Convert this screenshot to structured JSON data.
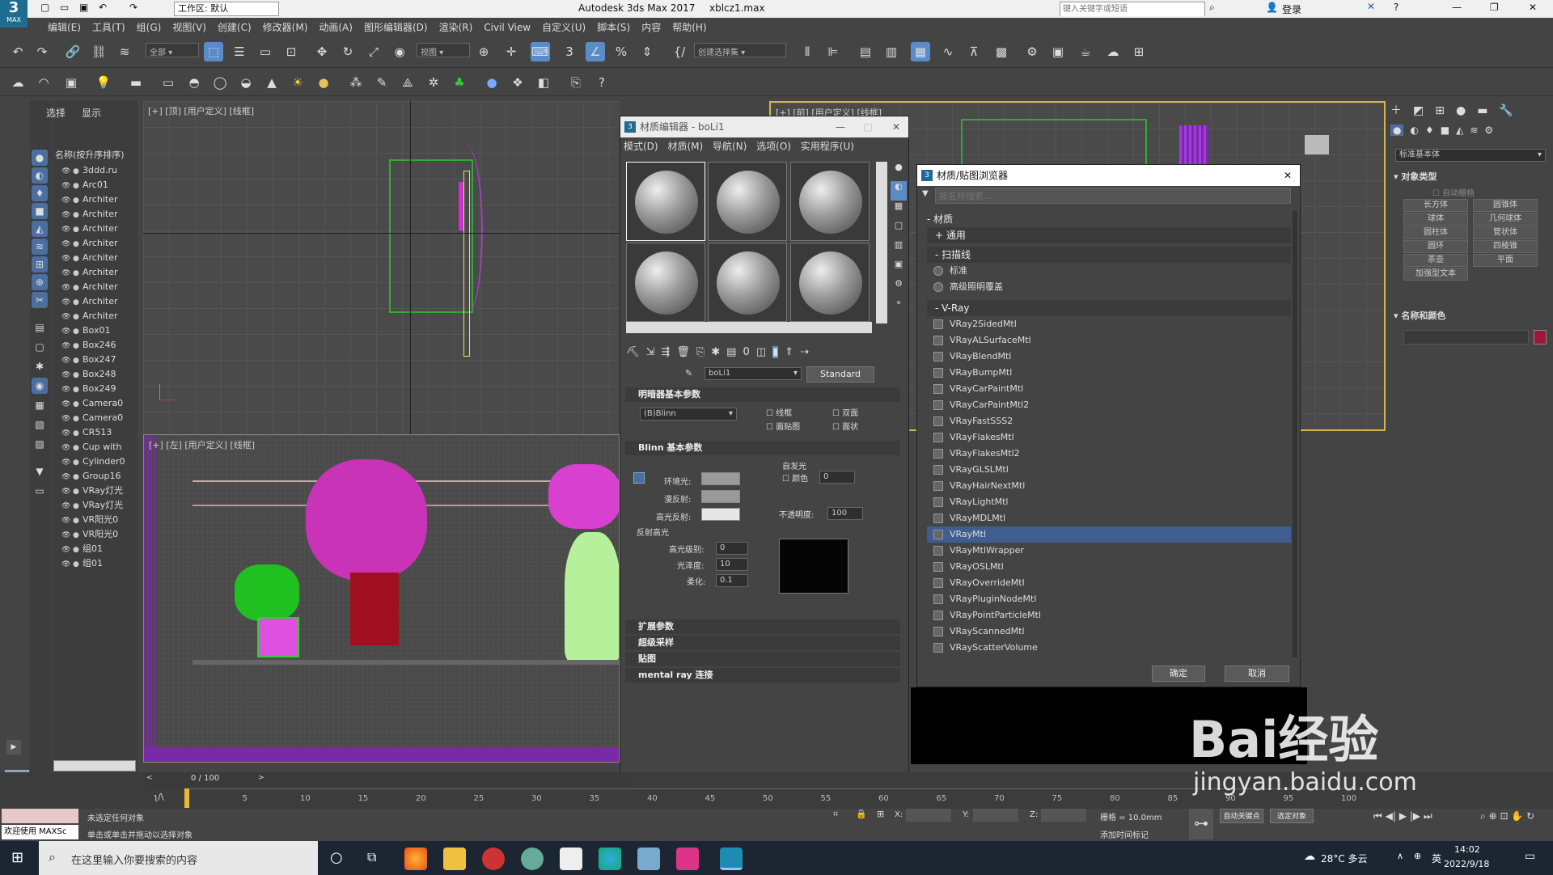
{
  "titlebar": {
    "logo": "3",
    "logo_sub": "MAX",
    "workspace": "工作区: 默认",
    "app_title": "Autodesk 3ds Max 2017",
    "file": "xblcz1.max",
    "search_placeholder": "键入关键字或短语",
    "login": "登录"
  },
  "menubar": [
    "编辑(E)",
    "工具(T)",
    "组(G)",
    "视图(V)",
    "创建(C)",
    "修改器(M)",
    "动画(A)",
    "图形编辑器(D)",
    "渲染(R)",
    "Civil View",
    "自定义(U)",
    "脚本(S)",
    "内容",
    "帮助(H)"
  ],
  "toolbar": {
    "filter_all": "全部",
    "view_mode": "视图",
    "selection_set": "创建选择集"
  },
  "explorer": {
    "tabs": [
      "选择",
      "显示"
    ],
    "header": "名称(按升序排序)",
    "items": [
      "3ddd.ru",
      "Arc01",
      "Architer",
      "Architer",
      "Architer",
      "Architer",
      "Architer",
      "Architer",
      "Architer",
      "Architer",
      "Architer",
      "Box01",
      "Box246",
      "Box247",
      "Box248",
      "Box249",
      "Camera0",
      "Camera0",
      "CR513",
      "Cup with",
      "Cylinder0",
      "Group16",
      "VRay灯光",
      "VRay灯光",
      "VR阳光0",
      "VR阳光0",
      "组01",
      "组01"
    ]
  },
  "viewports": {
    "top": "[+] [顶] [用户定义] [线框]",
    "front": "[+] [前] [用户定义] [线框]",
    "left": "[+] [左] [用户定义] [线框]",
    "frame_counter": "0 / 100"
  },
  "material_editor": {
    "title": "材质编辑器 - boLi1",
    "menu": [
      "模式(D)",
      "材质(M)",
      "导航(N)",
      "选项(O)",
      "实用程序(U)"
    ],
    "material_name": "boLi1",
    "material_type": "Standard",
    "shader_rollout": "明暗器基本参数",
    "shader": "(B)Blinn",
    "options": [
      "线框",
      "双面",
      "面贴图",
      "面状"
    ],
    "blinn_rollout": "Blinn 基本参数",
    "self_illum": "自发光",
    "color_label": "颜色",
    "self_illum_value": "0",
    "ambient": "环境光:",
    "diffuse": "漫反射:",
    "specular": "高光反射:",
    "opacity_label": "不透明度:",
    "opacity": "100",
    "spec_highlights": "反射高光",
    "spec_level_label": "高光级别:",
    "spec_level": "0",
    "glossiness_label": "光泽度:",
    "glossiness": "10",
    "soften_label": "柔化:",
    "soften": "0.1",
    "more_rollouts": [
      "扩展参数",
      "超级采样",
      "贴图",
      "mental ray 连接"
    ]
  },
  "browser": {
    "title": "材质/贴图浏览器",
    "search_placeholder": "按名称搜索...",
    "root": "- 材质",
    "general": "+ 通用",
    "scanline": "- 扫描线",
    "scanline_items": [
      "标准",
      "高级照明覆盖"
    ],
    "vray": "- V-Ray",
    "vray_items": [
      "VRay2SidedMtl",
      "VRayALSurfaceMtl",
      "VRayBlendMtl",
      "VRayBumpMtl",
      "VRayCarPaintMtl",
      "VRayCarPaintMtl2",
      "VRayFastSSS2",
      "VRayFlakesMtl",
      "VRayFlakesMtl2",
      "VRayGLSLMtl",
      "VRayHairNextMtl",
      "VRayLightMtl",
      "VRayMDLMtl",
      "VRayMtl",
      "VRayMtlWrapper",
      "VRayOSLMtl",
      "VRayOverrideMtl",
      "VRayPluginNodeMtl",
      "VRayPointParticleMtl",
      "VRayScannedMtl",
      "VRayScatterVolume"
    ],
    "selected": "VRayMtl",
    "ok": "确定",
    "cancel": "取消"
  },
  "command_panel": {
    "category": "标准基本体",
    "object_type": "对象类型",
    "autogrid": "自动栅格",
    "buttons": [
      "长方体",
      "圆锥体",
      "球体",
      "几何球体",
      "圆柱体",
      "管状体",
      "圆环",
      "四棱锥",
      "茶壶",
      "平面",
      "加强型文本"
    ],
    "name_color": "名称和颜色",
    "color_swatch": "#a0163a"
  },
  "timeline": {
    "ticks": [
      "0",
      "5",
      "10",
      "15",
      "20",
      "25",
      "30",
      "35",
      "40",
      "45",
      "50",
      "55",
      "60",
      "65",
      "70",
      "75",
      "80",
      "85",
      "90",
      "95",
      "100"
    ]
  },
  "status": {
    "welcome": "欢迎使用 MAXSc",
    "line1": "未选定任何对象",
    "line2": "单击或单击并拖动以选择对象",
    "x": "X:",
    "y": "Y:",
    "z": "Z:",
    "grid": "栅格 = 10.0mm",
    "add_tag": "添加时间标记",
    "auto_key": "自动关键点",
    "set_key": "选定对象"
  },
  "taskbar": {
    "search": "在这里输入你要搜索的内容",
    "weather": "28°C 多云",
    "ime": "英",
    "time": "14:02",
    "date": "2022/9/18"
  },
  "watermark": {
    "text": "Bai经验",
    "url": "jingyan.baidu.com"
  }
}
